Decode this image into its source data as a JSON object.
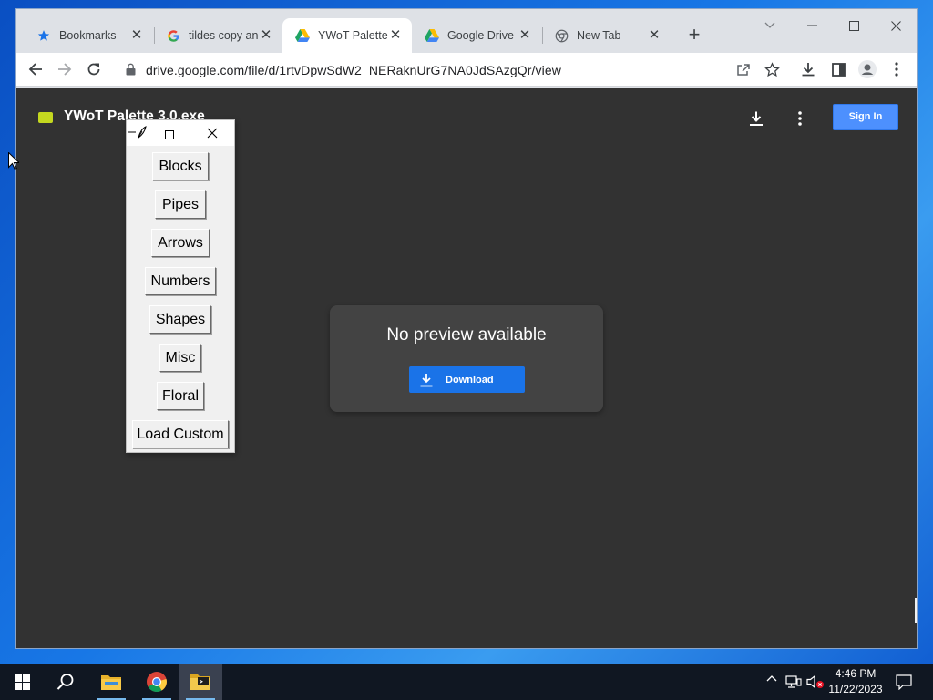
{
  "browser": {
    "tabs": [
      {
        "label": "Bookmarks",
        "icon": "star-icon"
      },
      {
        "label": "tildes copy and",
        "icon": "google-g-icon"
      },
      {
        "label": "YWoT Palette",
        "icon": "drive-icon",
        "active": true
      },
      {
        "label": "Google Drive",
        "icon": "drive-icon"
      },
      {
        "label": "New Tab",
        "icon": "chrome-icon"
      }
    ],
    "address": {
      "url": "drive.google.com/file/d/1rtvDpwSdW2_NERaknUrG7NA0JdSAzgQr/view"
    }
  },
  "viewer": {
    "file_title": "YWoT Palette 3.0.exe",
    "sign_in_label": "Sign In",
    "no_preview": "No preview available",
    "download_label": "Download"
  },
  "palette": {
    "buttons": [
      "Blocks",
      "Pipes",
      "Arrows",
      "Numbers",
      "Shapes",
      "Misc",
      "Floral",
      "Load Custom"
    ]
  },
  "taskbar": {
    "time": "4:46 PM",
    "date": "11/22/2023"
  },
  "colors": {
    "viewer_bg": "#323232",
    "accent_blue": "#1a73e8",
    "signin_blue": "#4d90fe",
    "file_icon": "#c4d81f"
  }
}
